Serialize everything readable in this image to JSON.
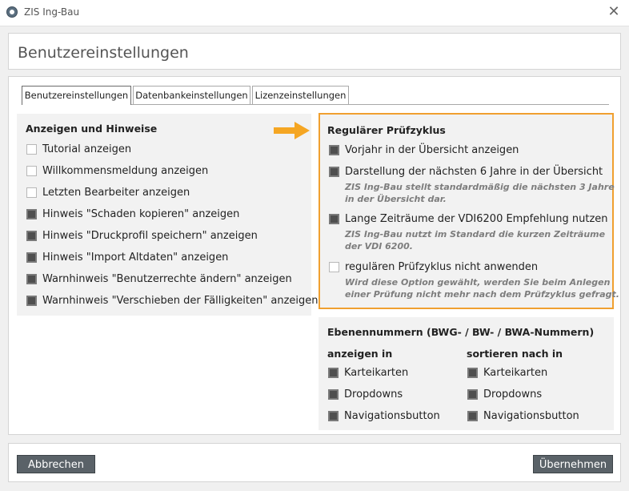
{
  "window": {
    "title": "ZIS Ing-Bau"
  },
  "header": {
    "title": "Benutzereinstellungen"
  },
  "tabs": [
    {
      "label": "Benutzereinstellungen",
      "active": true
    },
    {
      "label": "Datenbankeinstellungen",
      "active": false
    },
    {
      "label": "Lizenzeinstellungen",
      "active": false
    }
  ],
  "anzeigen": {
    "title": "Anzeigen und Hinweise",
    "items": [
      {
        "label": "Tutorial anzeigen",
        "checked": false
      },
      {
        "label": "Willkommensmeldung anzeigen",
        "checked": false
      },
      {
        "label": "Letzten Bearbeiter anzeigen",
        "checked": false
      },
      {
        "label": "Hinweis \"Schaden kopieren\" anzeigen",
        "checked": true
      },
      {
        "label": "Hinweis \"Druckprofil speichern\" anzeigen",
        "checked": true
      },
      {
        "label": "Hinweis \"Import Altdaten\" anzeigen",
        "checked": true
      },
      {
        "label": "Warnhinweis \"Benutzerrechte ändern\" anzeigen",
        "checked": true
      },
      {
        "label": "Warnhinweis \"Verschieben der Fälligkeiten\" anzeigen",
        "checked": true
      }
    ]
  },
  "pruefzyklus": {
    "title": "Regulärer Prüfzyklus",
    "items": [
      {
        "label": "Vorjahr in der Übersicht anzeigen",
        "checked": true,
        "note1": "",
        "note2": ""
      },
      {
        "label": "Darstellung der nächsten 6 Jahre in der Übersicht",
        "checked": true,
        "note1": "ZIS Ing-Bau stellt standardmäßig die nächsten 3 Jahre",
        "note2": "in der Übersicht dar."
      },
      {
        "label": "Lange Zeiträume der VDI6200 Empfehlung nutzen",
        "checked": true,
        "note1": "ZIS Ing-Bau nutzt im Standard die kurzen Zeiträume",
        "note2": "der VDI 6200."
      },
      {
        "label": "regulären Prüfzyklus nicht anwenden",
        "checked": false,
        "note1": "Wird diese Option gewählt, werden Sie beim Anlegen",
        "note2": "einer Prüfung nicht mehr nach dem Prüfzyklus gefragt."
      }
    ]
  },
  "ebenen": {
    "title": "Ebenennummern (BWG- / BW- / BWA-Nummern)",
    "anzeigen_title": "anzeigen in",
    "sortieren_title": "sortieren nach in",
    "anzeigen_items": [
      {
        "label": "Karteikarten",
        "checked": true
      },
      {
        "label": "Dropdowns",
        "checked": true
      },
      {
        "label": "Navigationsbutton",
        "checked": true
      }
    ],
    "sortieren_items": [
      {
        "label": "Karteikarten",
        "checked": true
      },
      {
        "label": "Dropdowns",
        "checked": true
      },
      {
        "label": "Navigationsbutton",
        "checked": true
      }
    ]
  },
  "footer": {
    "cancel_label": "Abbrechen",
    "apply_label": "Übernehmen"
  },
  "colors": {
    "highlight_border": "#f0a030",
    "arrow": "#f5a623",
    "button": "#5a6268"
  }
}
